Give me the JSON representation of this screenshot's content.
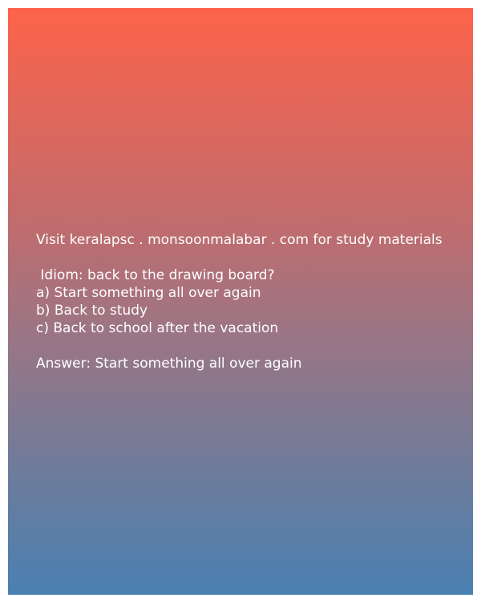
{
  "promo_line": "Visit keralapsc . monsoonmalabar . com for study materials",
  "question": " Idiom: back to the drawing board?",
  "options": [
    "a) Start something all over again",
    "b) Back to study",
    "c) Back to school after the vacation"
  ],
  "answer": "Answer: Start something all over again",
  "colors": {
    "gradient_top": "#fd634a",
    "gradient_bottom": "#4a80b2",
    "text": "#ffffff"
  }
}
